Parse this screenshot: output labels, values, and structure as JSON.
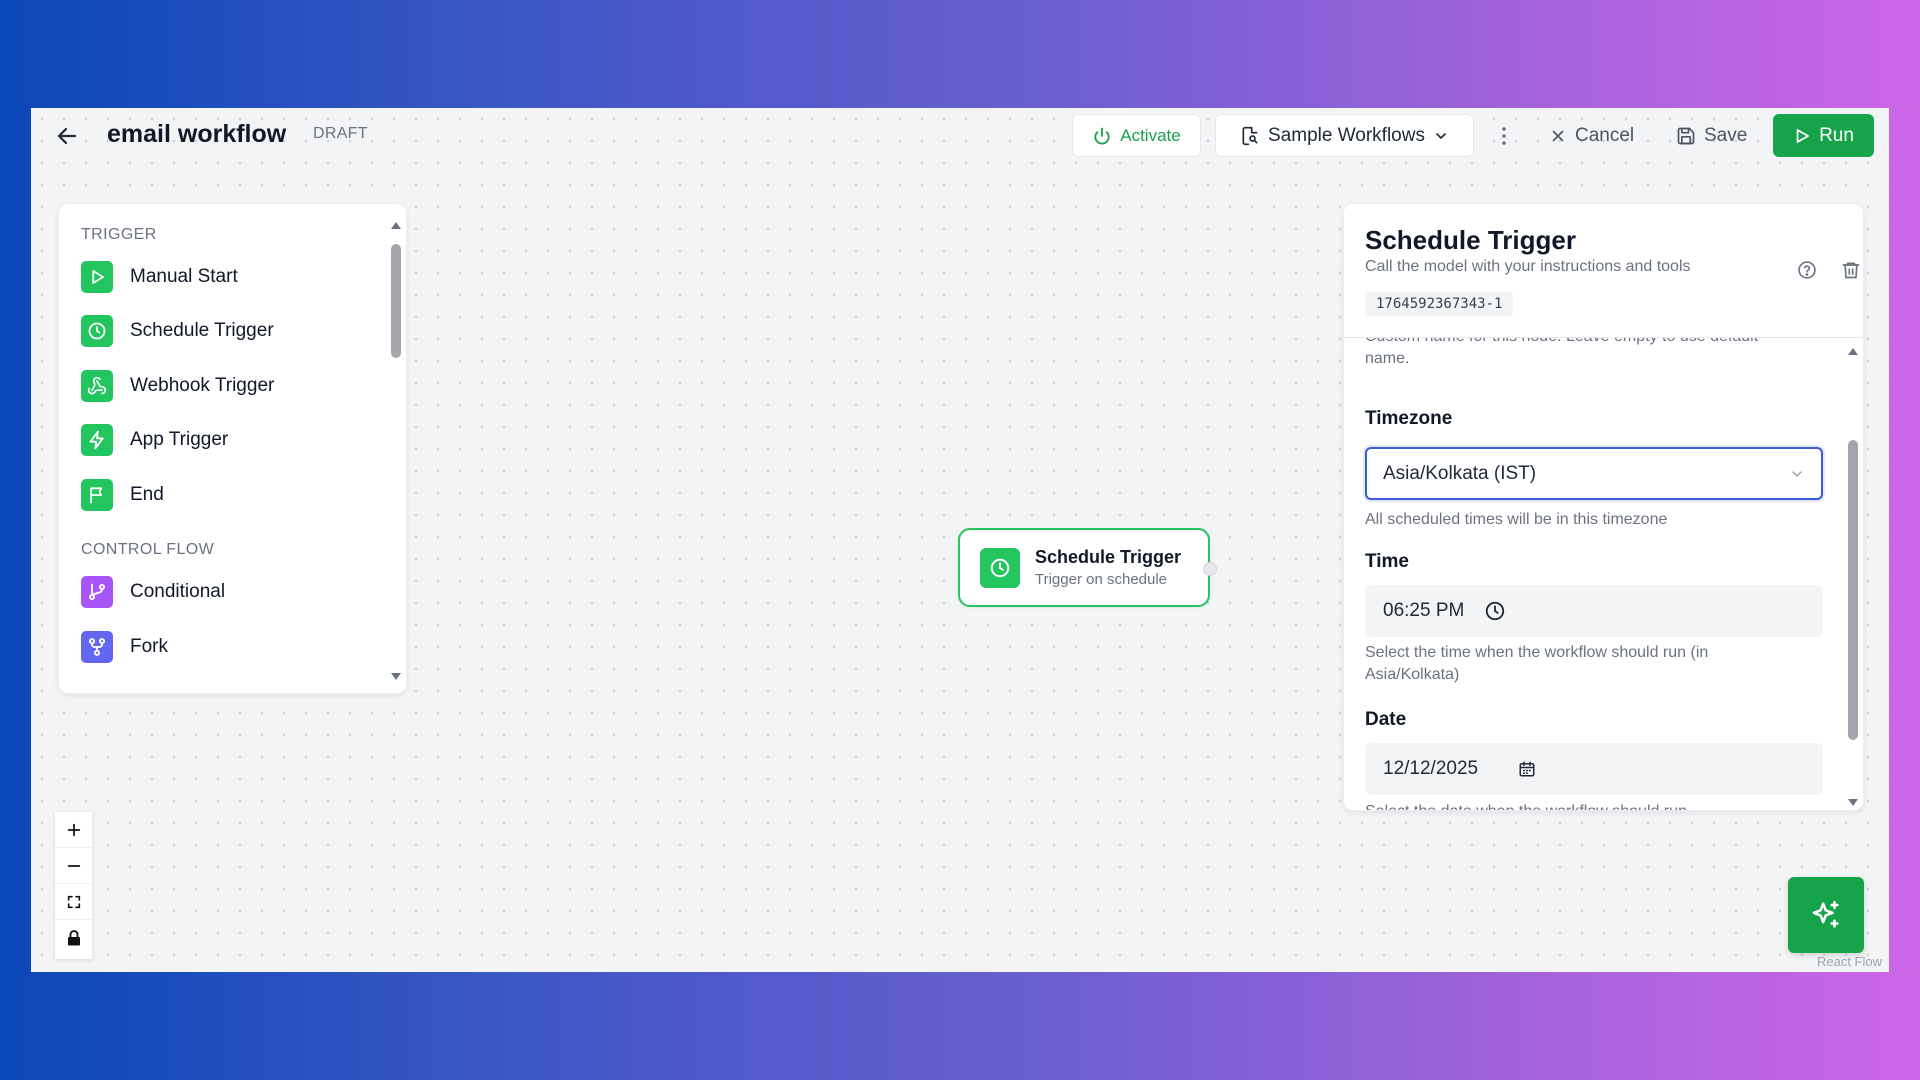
{
  "header": {
    "title": "email workflow",
    "status": "DRAFT",
    "activate_label": "Activate",
    "samples_label": "Sample Workflows",
    "cancel_label": "Cancel",
    "save_label": "Save",
    "run_label": "Run"
  },
  "palette": {
    "sections": [
      {
        "title": "TRIGGER",
        "items": [
          "Manual Start",
          "Schedule Trigger",
          "Webhook Trigger",
          "App Trigger",
          "End"
        ]
      },
      {
        "title": "CONTROL FLOW",
        "items": [
          "Conditional",
          "Fork"
        ]
      }
    ]
  },
  "canvas": {
    "node": {
      "title": "Schedule Trigger",
      "subtitle": "Trigger on schedule"
    },
    "attribution": "React Flow"
  },
  "panel": {
    "title": "Schedule Trigger",
    "description": "Call the model with your instructions and tools",
    "node_id": "1764592367343-1",
    "name_help": "Custom name for this node. Leave empty to use default name.",
    "timezone": {
      "label": "Timezone",
      "value": "Asia/Kolkata (IST)",
      "help": "All scheduled times will be in this timezone"
    },
    "time": {
      "label": "Time",
      "value": "06:25 PM",
      "help": "Select the time when the workflow should run (in Asia/Kolkata)"
    },
    "date": {
      "label": "Date",
      "value": "12/12/2025",
      "help": "Select the date when the workflow should run"
    }
  },
  "colors": {
    "accent": "#16a34a",
    "node_green": "#22c55e",
    "purple": "#a855f7",
    "indigo": "#6366f1",
    "focus_blue": "#3b5bdb"
  }
}
